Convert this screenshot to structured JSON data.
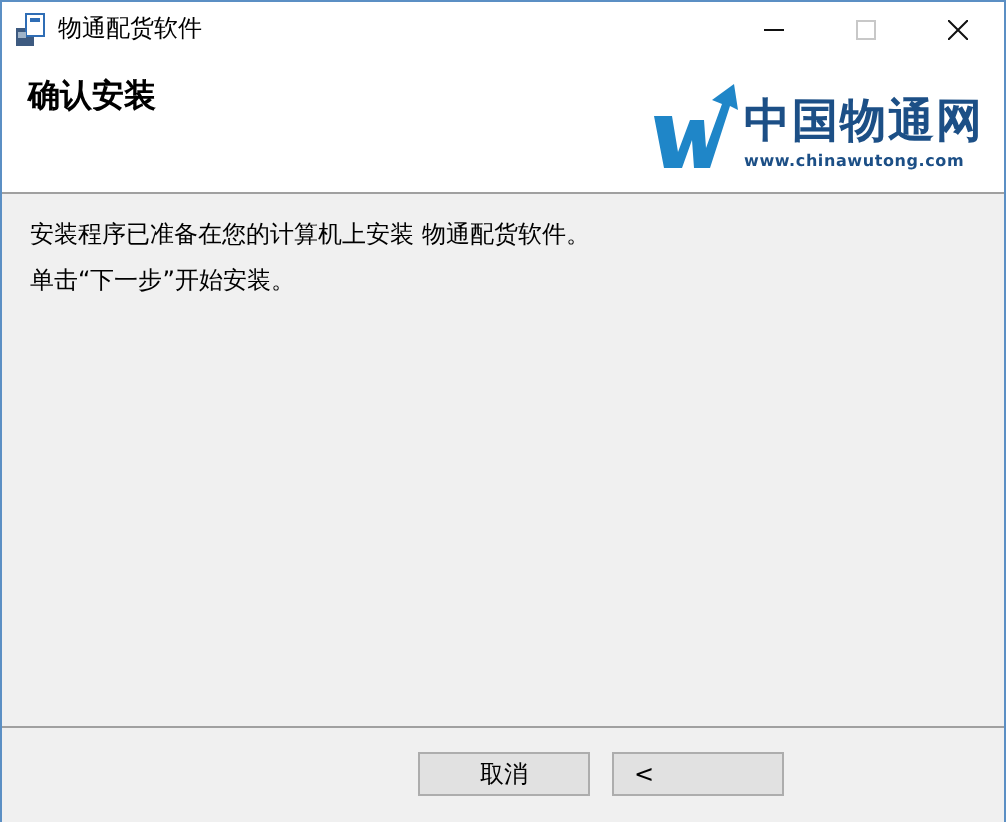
{
  "window": {
    "title": "物通配货软件",
    "controls": [
      {
        "kind": "minimize",
        "disabled": false
      },
      {
        "kind": "maximize",
        "disabled": true
      },
      {
        "kind": "close",
        "disabled": false
      }
    ]
  },
  "header": {
    "title": "确认安装",
    "logo": {
      "name": "中国物通网",
      "url": "www.chinawutong.com"
    }
  },
  "messages": [
    "安装程序已准备在您的计算机上安装 物通配货软件。",
    "单击“下一步”开始安装。"
  ],
  "buttons": [
    {
      "label": "取消",
      "kind": "cancel"
    },
    {
      "label": "<",
      "kind": "back"
    }
  ]
}
